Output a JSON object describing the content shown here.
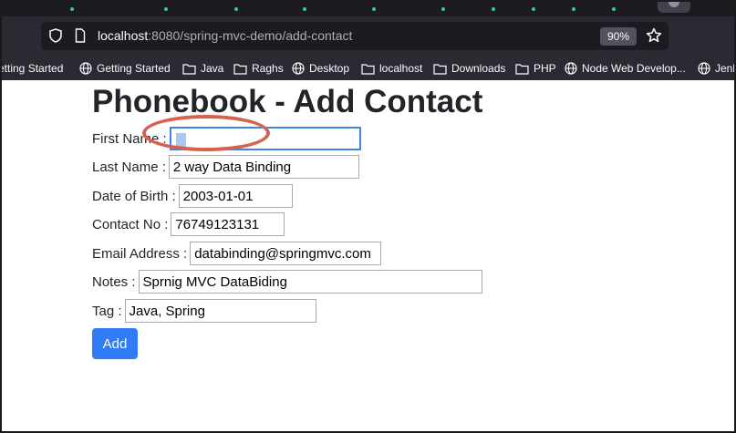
{
  "browser": {
    "url_host": "localhost",
    "url_path": ":8080/spring-mvc-demo/add-contact",
    "zoom": "90%",
    "bookmarks": [
      {
        "label": "etting Started",
        "icon": "none"
      },
      {
        "label": "Getting Started",
        "icon": "globe-icon"
      },
      {
        "label": "Java",
        "icon": "folder-icon"
      },
      {
        "label": "Raghs",
        "icon": "folder-icon"
      },
      {
        "label": "Desktop",
        "icon": "globe-icon"
      },
      {
        "label": "localhost",
        "icon": "folder-icon"
      },
      {
        "label": "Downloads",
        "icon": "folder-icon"
      },
      {
        "label": "PHP",
        "icon": "folder-icon"
      },
      {
        "label": "Node Web Develop...",
        "icon": "globe-icon"
      },
      {
        "label": "Jenk",
        "icon": "globe-icon"
      }
    ]
  },
  "page": {
    "title": "Phonebook - Add Contact",
    "fields": [
      {
        "label": "First Name :",
        "value": ""
      },
      {
        "label": "Last Name :",
        "value": "2 way Data Binding"
      },
      {
        "label": "Date of Birth :",
        "value": "2003-01-01"
      },
      {
        "label": "Contact No :",
        "value": "76749123131"
      },
      {
        "label": "Email Address :",
        "value": "databinding@springmvc.com"
      },
      {
        "label": "Notes :",
        "value": "Sprnig MVC DataBiding"
      },
      {
        "label": "Tag :",
        "value": "Java, Spring"
      }
    ],
    "submit_label": "Add"
  },
  "colors": {
    "accent": "#2f7cf6",
    "annotation": "#d4624d",
    "focus": "#3b86e0"
  }
}
